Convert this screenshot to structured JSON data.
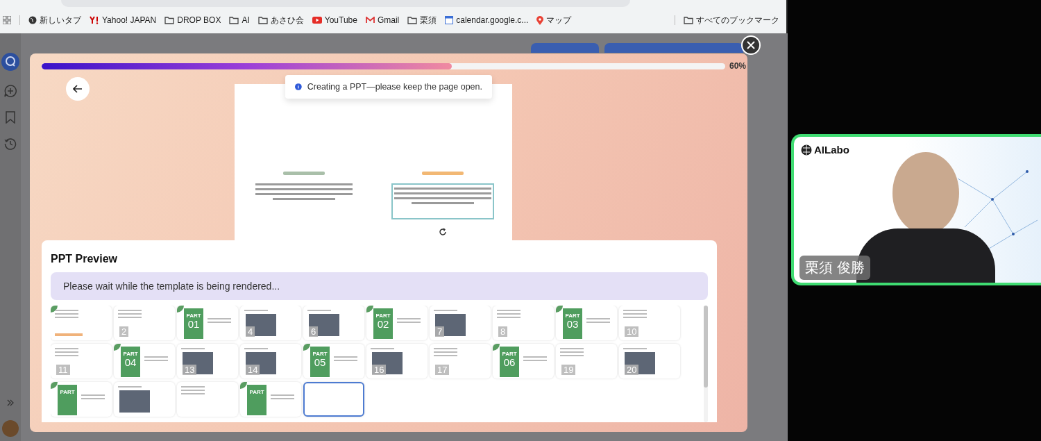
{
  "browser": {
    "bookmarks": [
      {
        "label": "新しいタブ",
        "kind": "globe"
      },
      {
        "label": "Yahoo! JAPAN",
        "kind": "yahoo"
      },
      {
        "label": "DROP BOX",
        "kind": "folder"
      },
      {
        "label": "AI",
        "kind": "folder"
      },
      {
        "label": "あさひ会",
        "kind": "folder"
      },
      {
        "label": "YouTube",
        "kind": "youtube"
      },
      {
        "label": "Gmail",
        "kind": "gmail"
      },
      {
        "label": "栗須",
        "kind": "folder"
      },
      {
        "label": "calendar.google.c...",
        "kind": "calendar"
      },
      {
        "label": "マップ",
        "kind": "maps"
      }
    ],
    "all_bookmarks": "すべてのブックマーク"
  },
  "modal": {
    "progress": {
      "level": 0.6,
      "reading": "60%"
    },
    "toast": "Creating a PPT—please keep the page open.",
    "preview": {
      "title": "PPT Preview",
      "status": "Please wait while the template is being rendered...",
      "thumbnails": [
        {
          "kind": "cover",
          "selected": false
        },
        {
          "kind": "content",
          "number": "2",
          "selected": false
        },
        {
          "kind": "part",
          "part_label": "PART",
          "number": "01",
          "selected": false
        },
        {
          "kind": "photo",
          "number": "4",
          "selected": false
        },
        {
          "kind": "photo",
          "number": "6",
          "selected": false
        },
        {
          "kind": "part",
          "part_label": "PART",
          "number": "02",
          "selected": false
        },
        {
          "kind": "photo",
          "number": "7",
          "selected": false
        },
        {
          "kind": "content",
          "number": "8",
          "selected": false
        },
        {
          "kind": "part",
          "part_label": "PART",
          "number": "03",
          "selected": false
        },
        {
          "kind": "content",
          "number": "10",
          "selected": false
        },
        {
          "kind": "content",
          "number": "11",
          "selected": false
        },
        {
          "kind": "part",
          "part_label": "PART",
          "number": "04",
          "selected": false
        },
        {
          "kind": "photo",
          "number": "13",
          "selected": false
        },
        {
          "kind": "photo",
          "number": "14",
          "selected": false
        },
        {
          "kind": "part",
          "part_label": "PART",
          "number": "05",
          "selected": false
        },
        {
          "kind": "photo",
          "number": "16",
          "selected": false
        },
        {
          "kind": "content",
          "number": "17",
          "selected": false
        },
        {
          "kind": "part",
          "part_label": "PART",
          "number": "06",
          "selected": false
        },
        {
          "kind": "content",
          "number": "19",
          "selected": false
        },
        {
          "kind": "photo",
          "number": "20",
          "selected": false
        },
        {
          "kind": "part",
          "part_label": "PART",
          "selected": false
        },
        {
          "kind": "photo",
          "selected": false
        },
        {
          "kind": "content",
          "selected": false
        },
        {
          "kind": "part",
          "part_label": "PART",
          "selected": false
        },
        {
          "kind": "blank",
          "selected": true
        }
      ]
    }
  },
  "video": {
    "logo": "AILabo",
    "name": "栗須 俊勝"
  }
}
